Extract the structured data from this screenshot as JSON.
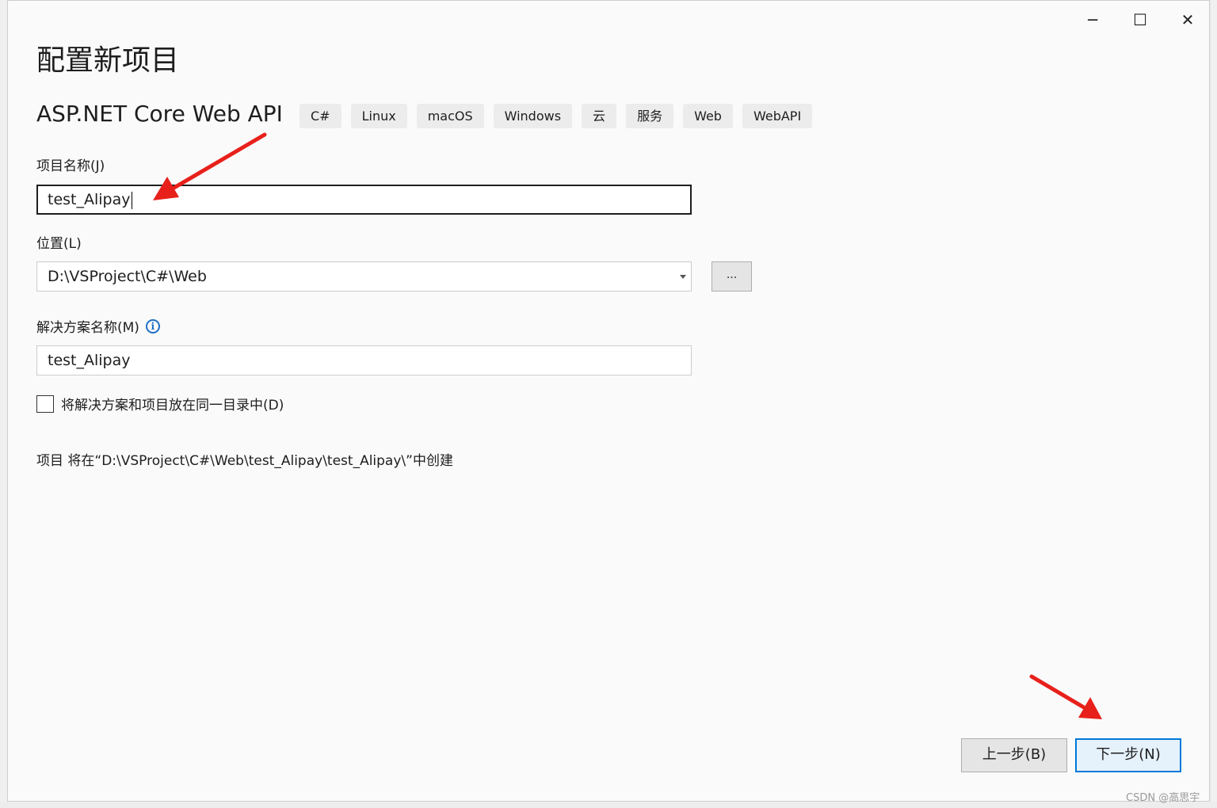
{
  "window": {
    "title": "配置新项目",
    "controls": {
      "minimize": "─",
      "maximize": "☐",
      "close": "✕"
    }
  },
  "template": {
    "name": "ASP.NET Core Web API",
    "tags": [
      "C#",
      "Linux",
      "macOS",
      "Windows",
      "云",
      "服务",
      "Web",
      "WebAPI"
    ]
  },
  "form": {
    "project_name_label": "项目名称(J)",
    "project_name_value": "test_Alipay",
    "location_label": "位置(L)",
    "location_value": "D:\\VSProject\\C#\\Web",
    "browse_label": "...",
    "solution_name_label": "解决方案名称(M)",
    "solution_name_value": "test_Alipay",
    "same_dir_label": "将解决方案和项目放在同一目录中(D)",
    "same_dir_checked": false,
    "path_note": "项目 将在“D:\\VSProject\\C#\\Web\\test_Alipay\\test_Alipay\\”中创建"
  },
  "footer": {
    "back_label": "上一步(B)",
    "next_label": "下一步(N)"
  },
  "watermark": "CSDN @高思宇",
  "colors": {
    "accent": "#0078d7",
    "annotation_arrow": "#e8201b",
    "info_icon": "#1f6fc5"
  },
  "icons": {
    "info": "info-icon",
    "dropdown": "chevron-down-icon"
  }
}
